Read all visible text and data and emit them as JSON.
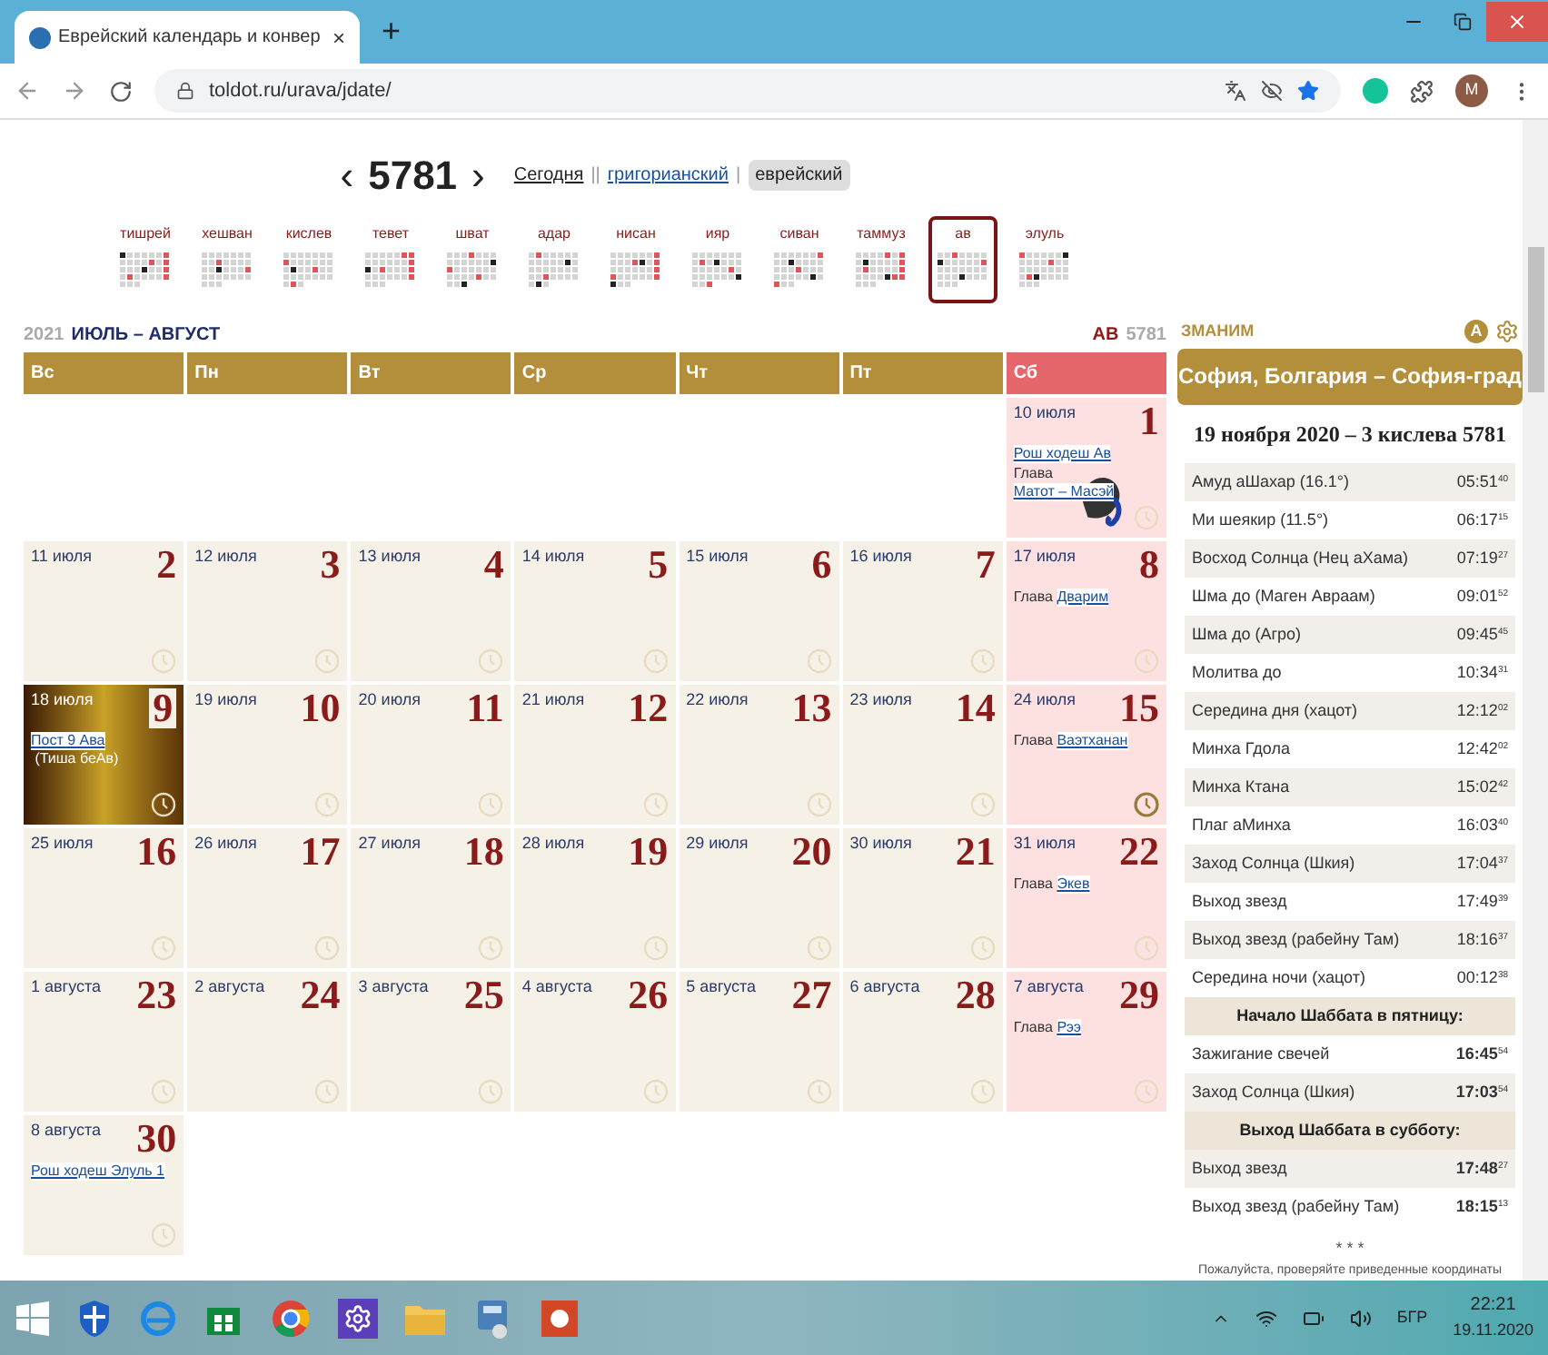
{
  "browser": {
    "tab_title": "Еврейский календарь и конвер",
    "tab_close": "×",
    "new_tab": "+",
    "url": "toldot.ru/urava/jdate/",
    "avatar": "M"
  },
  "year_nav": {
    "prev": "‹",
    "year": "5781",
    "next": "›",
    "links": [
      {
        "label": "Сегодня",
        "selected": false
      },
      {
        "label": "григорианский",
        "selected": false
      },
      {
        "label": "еврейский",
        "selected": true
      }
    ],
    "separators": [
      "||",
      "|"
    ]
  },
  "months": [
    {
      "name": "тишрей",
      "selected": false
    },
    {
      "name": "хешван",
      "selected": false
    },
    {
      "name": "кислев",
      "selected": false
    },
    {
      "name": "тевет",
      "selected": false
    },
    {
      "name": "шват",
      "selected": false
    },
    {
      "name": "адар",
      "selected": false
    },
    {
      "name": "нисан",
      "selected": false
    },
    {
      "name": "ияр",
      "selected": false
    },
    {
      "name": "сиван",
      "selected": false
    },
    {
      "name": "таммуз",
      "selected": false
    },
    {
      "name": "ав",
      "selected": true
    },
    {
      "name": "элуль",
      "selected": false
    }
  ],
  "calendar": {
    "greg_year": "2021",
    "greg_months": "ИЮЛЬ – АВГУСТ",
    "heb_month": "АВ",
    "heb_year": "5781",
    "days": [
      {
        "label": "Вс",
        "shabbat": false
      },
      {
        "label": "Пн",
        "shabbat": false
      },
      {
        "label": "Вт",
        "shabbat": false
      },
      {
        "label": "Ср",
        "shabbat": false
      },
      {
        "label": "Чт",
        "shabbat": false
      },
      {
        "label": "Пт",
        "shabbat": false
      },
      {
        "label": "Сб",
        "shabbat": true
      }
    ],
    "weeks": [
      [
        {
          "kind": "empty"
        },
        {
          "kind": "empty"
        },
        {
          "kind": "empty"
        },
        {
          "kind": "empty"
        },
        {
          "kind": "empty"
        },
        {
          "kind": "empty"
        },
        {
          "kind": "zodiac_day",
          "greg": "10 июля",
          "heb": "1",
          "shabbat": true,
          "clock_active": false,
          "events": [
            [
              {
                "kind": "link",
                "text": "Рош ходеш Ав"
              }
            ],
            [
              {
                "kind": "text",
                "text": "Глава "
              },
              {
                "kind": "link",
                "text": "Матот – Масэй"
              }
            ]
          ]
        }
      ],
      [
        {
          "kind": "day",
          "greg": "11 июля",
          "heb": "2",
          "shabbat": false,
          "clock_active": false
        },
        {
          "kind": "day",
          "greg": "12 июля",
          "heb": "3",
          "shabbat": false,
          "clock_active": false
        },
        {
          "kind": "day",
          "greg": "13 июля",
          "heb": "4",
          "shabbat": false,
          "clock_active": false
        },
        {
          "kind": "day",
          "greg": "14 июля",
          "heb": "5",
          "shabbat": false,
          "clock_active": false
        },
        {
          "kind": "day",
          "greg": "15 июля",
          "heb": "6",
          "shabbat": false,
          "clock_active": false
        },
        {
          "kind": "day",
          "greg": "16 июля",
          "heb": "7",
          "shabbat": false,
          "clock_active": false
        },
        {
          "kind": "day",
          "greg": "17 июля",
          "heb": "8",
          "shabbat": true,
          "clock_active": false,
          "events": [
            [
              {
                "kind": "text",
                "text": "Глава "
              },
              {
                "kind": "link",
                "text": "Дварим"
              }
            ]
          ]
        }
      ],
      [
        {
          "kind": "photo_day",
          "greg": "18 июля",
          "heb": "9",
          "shabbat": false,
          "clock_active": false,
          "events": [
            [
              {
                "kind": "link",
                "text": "Пост 9 Ава"
              },
              {
                "kind": "text",
                "text": " (Тиша беАв)"
              }
            ]
          ]
        },
        {
          "kind": "day",
          "greg": "19 июля",
          "heb": "10",
          "shabbat": false,
          "clock_active": false
        },
        {
          "kind": "day",
          "greg": "20 июля",
          "heb": "11",
          "shabbat": false,
          "clock_active": false
        },
        {
          "kind": "day",
          "greg": "21 июля",
          "heb": "12",
          "shabbat": false,
          "clock_active": false
        },
        {
          "kind": "day",
          "greg": "22 июля",
          "heb": "13",
          "shabbat": false,
          "clock_active": false
        },
        {
          "kind": "day",
          "greg": "23 июля",
          "heb": "14",
          "shabbat": false,
          "clock_active": false
        },
        {
          "kind": "day",
          "greg": "24 июля",
          "heb": "15",
          "shabbat": true,
          "clock_active": true,
          "events": [
            [
              {
                "kind": "text",
                "text": "Глава "
              },
              {
                "kind": "link",
                "text": "Ваэтханан"
              }
            ]
          ]
        }
      ],
      [
        {
          "kind": "day",
          "greg": "25 июля",
          "heb": "16",
          "shabbat": false,
          "clock_active": false
        },
        {
          "kind": "day",
          "greg": "26 июля",
          "heb": "17",
          "shabbat": false,
          "clock_active": false
        },
        {
          "kind": "day",
          "greg": "27 июля",
          "heb": "18",
          "shabbat": false,
          "clock_active": false
        },
        {
          "kind": "day",
          "greg": "28 июля",
          "heb": "19",
          "shabbat": false,
          "clock_active": false
        },
        {
          "kind": "day",
          "greg": "29 июля",
          "heb": "20",
          "shabbat": false,
          "clock_active": false
        },
        {
          "kind": "day",
          "greg": "30 июля",
          "heb": "21",
          "shabbat": false,
          "clock_active": false
        },
        {
          "kind": "day",
          "greg": "31 июля",
          "heb": "22",
          "shabbat": true,
          "clock_active": false,
          "events": [
            [
              {
                "kind": "text",
                "text": "Глава "
              },
              {
                "kind": "link",
                "text": "Экев"
              }
            ]
          ]
        }
      ],
      [
        {
          "kind": "day",
          "greg": "1 августа",
          "heb": "23",
          "shabbat": false,
          "clock_active": false
        },
        {
          "kind": "day",
          "greg": "2 августа",
          "heb": "24",
          "shabbat": false,
          "clock_active": false
        },
        {
          "kind": "day",
          "greg": "3 августа",
          "heb": "25",
          "shabbat": false,
          "clock_active": false
        },
        {
          "kind": "day",
          "greg": "4 августа",
          "heb": "26",
          "shabbat": false,
          "clock_active": false
        },
        {
          "kind": "day",
          "greg": "5 августа",
          "heb": "27",
          "shabbat": false,
          "clock_active": false
        },
        {
          "kind": "day",
          "greg": "6 августа",
          "heb": "28",
          "shabbat": false,
          "clock_active": false
        },
        {
          "kind": "day",
          "greg": "7 августа",
          "heb": "29",
          "shabbat": true,
          "clock_active": false,
          "events": [
            [
              {
                "kind": "text",
                "text": "Глава "
              },
              {
                "kind": "link",
                "text": "Рээ"
              }
            ]
          ]
        }
      ],
      [
        {
          "kind": "day",
          "greg": "8 августа",
          "heb": "30",
          "shabbat": false,
          "clock_active": false,
          "events": [
            [
              {
                "kind": "link",
                "text": "Рош ходеш Элуль 1"
              }
            ]
          ]
        }
      ]
    ]
  },
  "zmanim": {
    "title": "ЗМАНИМ",
    "lang_badge": "A",
    "location": "София, Болгария – София-град",
    "date": "19 ноября 2020 – 3 кислева 5781",
    "rows": [
      {
        "kind": "row",
        "name": "Амуд аШахар (16.1°)",
        "time": "05:51",
        "sec": "40",
        "bold": false
      },
      {
        "kind": "row",
        "name": "Ми шеякир (11.5°)",
        "time": "06:17",
        "sec": "15",
        "bold": false
      },
      {
        "kind": "row",
        "name": "Восход Солнца (Нец аХама)",
        "time": "07:19",
        "sec": "27",
        "bold": false
      },
      {
        "kind": "row",
        "name": "Шма до (Маген Авраам)",
        "time": "09:01",
        "sec": "52",
        "bold": false
      },
      {
        "kind": "row",
        "name": "Шма до (Агро)",
        "time": "09:45",
        "sec": "45",
        "bold": false
      },
      {
        "kind": "row",
        "name": "Молитва до",
        "time": "10:34",
        "sec": "31",
        "bold": false
      },
      {
        "kind": "row",
        "name": "Середина дня (хацот)",
        "time": "12:12",
        "sec": "02",
        "bold": false
      },
      {
        "kind": "row",
        "name": "Минха Гдола",
        "time": "12:42",
        "sec": "02",
        "bold": false
      },
      {
        "kind": "row",
        "name": "Минха Ктана",
        "time": "15:02",
        "sec": "42",
        "bold": false
      },
      {
        "kind": "row",
        "name": "Плаг аМинха",
        "time": "16:03",
        "sec": "40",
        "bold": false
      },
      {
        "kind": "row",
        "name": "Заход Солнца (Шкия)",
        "time": "17:04",
        "sec": "37",
        "bold": false
      },
      {
        "kind": "row",
        "name": "Выход звезд",
        "time": "17:49",
        "sec": "39",
        "bold": false
      },
      {
        "kind": "row",
        "name": "Выход звезд (рабейну Там)",
        "time": "18:16",
        "sec": "37",
        "bold": false
      },
      {
        "kind": "row",
        "name": "Середина ночи (хацот)",
        "time": "00:12",
        "sec": "38",
        "bold": false
      },
      {
        "kind": "header",
        "name": "Начало Шаббата в пятницу:"
      },
      {
        "kind": "row",
        "name": "Зажигание свечей",
        "time": "16:45",
        "sec": "54",
        "bold": true
      },
      {
        "kind": "row",
        "name": "Заход Солнца (Шкия)",
        "time": "17:03",
        "sec": "54",
        "bold": true
      },
      {
        "kind": "header",
        "name": "Выход Шаббата в субботу:"
      },
      {
        "kind": "row",
        "name": "Выход звезд",
        "time": "17:48",
        "sec": "27",
        "bold": true
      },
      {
        "kind": "row",
        "name": "Выход звезд (рабейну Там)",
        "time": "18:15",
        "sec": "13",
        "bold": true
      }
    ],
    "stars": "* * *",
    "note": "Пожалуйста, проверяйте приведенные координаты"
  },
  "taskbar": {
    "lang": "БГР",
    "time": "22:21",
    "date": "19.11.2020"
  }
}
